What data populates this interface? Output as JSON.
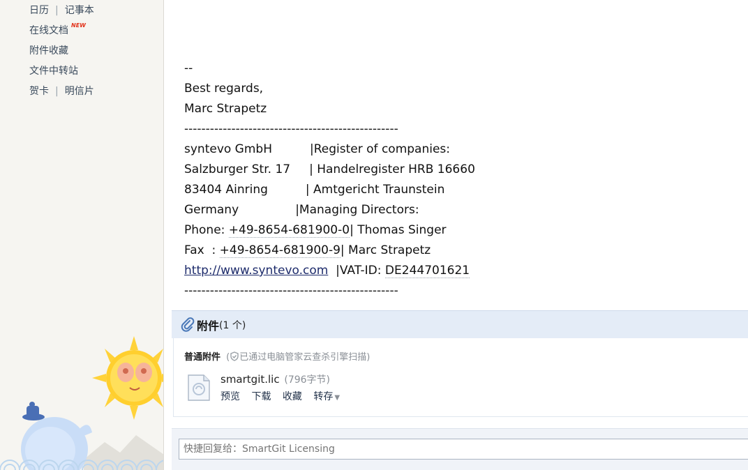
{
  "sidebar": {
    "row1": {
      "calendar": "日历",
      "separator": "|",
      "notepad": "记事本"
    },
    "row2": {
      "online_docs": "在线文档",
      "new_badge": "NEW"
    },
    "row3": {
      "attachment_favorites": "附件收藏"
    },
    "row4": {
      "file_transfer": "文件中转站"
    },
    "row5": {
      "greeting_cards": "贺卡",
      "separator": "|",
      "postcards": "明信片"
    }
  },
  "mail": {
    "lines": [
      "--",
      "Best regards,",
      "Marc Strapetz",
      "--------------------------------------------------",
      "syntevo GmbH          |Register of companies:",
      "Salzburger Str. 17     | Handelregister HRB 16660",
      "83404 Ainring          | Amtgericht Traunstein",
      "Germany               |Managing Directors:"
    ],
    "phone_prefix": "Phone: ",
    "phone_number": "+49-8654-681900-0",
    "phone_suffix": "| Thomas Singer",
    "fax_prefix": "Fax  : ",
    "fax_number": "+49-8654-681900-9",
    "fax_suffix": "| Marc Strapetz",
    "website": "http://www.syntevo.com",
    "vat_prefix": "  |VAT-ID: ",
    "vat_id": "DE244701621",
    "closing_rule": "--------------------------------------------------"
  },
  "attachments": {
    "title": "附件",
    "count": "(1 个)",
    "kind_label": "普通附件",
    "scan_open": "(",
    "scan_status": "已通过电脑管家云查杀引擎扫描",
    "scan_close": ")",
    "file": {
      "name": "smartgit.lic",
      "size": "(796字节)",
      "actions": {
        "preview": "预览",
        "download": "下载",
        "favorite": "收藏",
        "save_to": "转存"
      }
    }
  },
  "quick_reply": {
    "placeholder": "快捷回复给：SmartGit Licensing"
  },
  "colors": {
    "sidebar_bg": "#f6f5f1",
    "attachment_header_bg": "#e4ecf7",
    "new_badge": "#e2331b",
    "link": "#1d2b6b"
  }
}
